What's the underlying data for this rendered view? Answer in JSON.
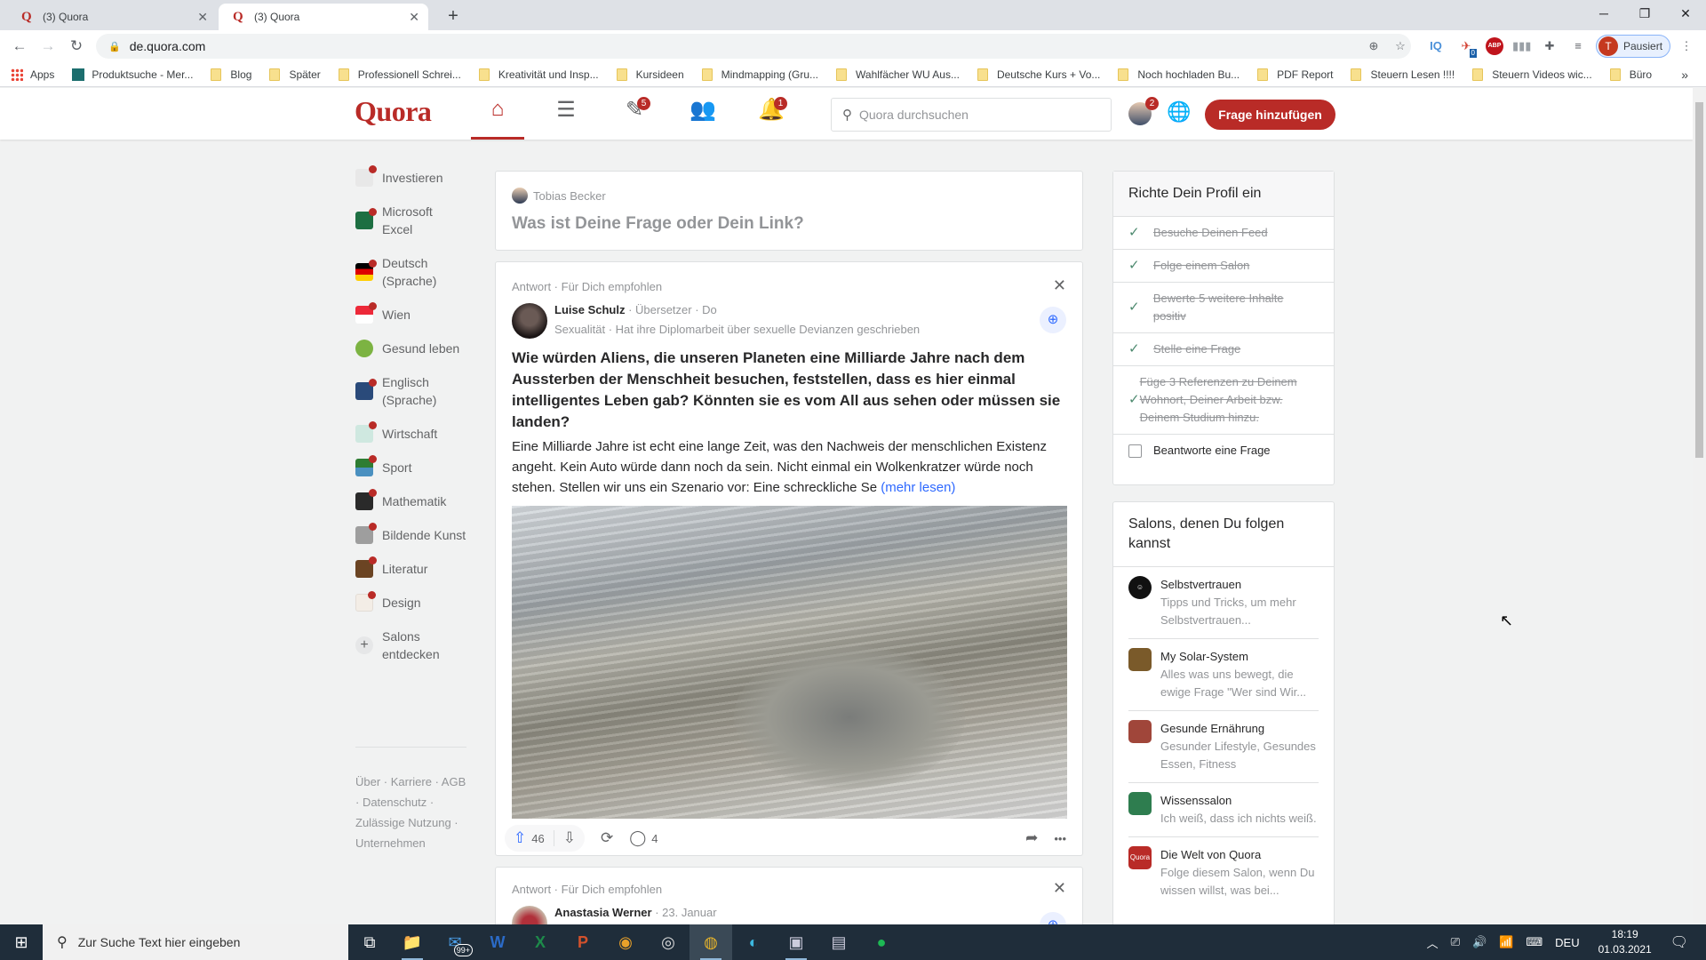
{
  "browser": {
    "tabs": [
      {
        "title": "(3) Quora",
        "active": false
      },
      {
        "title": "(3) Quora",
        "active": true
      }
    ],
    "url": "de.quora.com",
    "profile_initial": "T",
    "profile_label": "Pausiert",
    "extensions": [
      "zoom-icon",
      "star-icon",
      "IQ",
      "bird-extension-icon",
      "ABP",
      "bars-icon",
      "puzzle-icon",
      "media-icon"
    ],
    "ext_badge": "0",
    "bookmarks": [
      {
        "label": "Apps",
        "type": "apps"
      },
      {
        "label": "Produktsuche - Mer...",
        "type": "site"
      },
      {
        "label": "Blog",
        "type": "folder"
      },
      {
        "label": "Später",
        "type": "folder"
      },
      {
        "label": "Professionell Schrei...",
        "type": "folder"
      },
      {
        "label": "Kreativität und Insp...",
        "type": "folder"
      },
      {
        "label": "Kursideen",
        "type": "folder"
      },
      {
        "label": "Mindmapping  (Gru...",
        "type": "folder"
      },
      {
        "label": "Wahlfächer WU Aus...",
        "type": "folder"
      },
      {
        "label": "Deutsche Kurs + Vo...",
        "type": "folder"
      },
      {
        "label": "Noch hochladen Bu...",
        "type": "folder"
      },
      {
        "label": "PDF Report",
        "type": "folder"
      },
      {
        "label": "Steuern Lesen !!!!",
        "type": "folder"
      },
      {
        "label": "Steuern Videos wic...",
        "type": "folder"
      },
      {
        "label": "Büro",
        "type": "folder"
      }
    ],
    "bookmarks_more": "»"
  },
  "header": {
    "logo": "Quora",
    "nav": [
      {
        "name": "home",
        "badge": null,
        "active": true
      },
      {
        "name": "following",
        "badge": null
      },
      {
        "name": "answer",
        "badge": "5"
      },
      {
        "name": "spaces",
        "badge": null
      },
      {
        "name": "notifications",
        "badge": "1"
      }
    ],
    "search_placeholder": "Quora durchsuchen",
    "avatar_badge": "2",
    "add_question": "Frage hinzufügen"
  },
  "sidebar": {
    "items": [
      {
        "label": "Investieren",
        "color": "#e8e8e8",
        "dot": true
      },
      {
        "label": "Microsoft Excel",
        "color": "#1d6f42",
        "dot": true
      },
      {
        "label": "Deutsch (Sprache)",
        "color": "#dd0000",
        "dot": true
      },
      {
        "label": "Wien",
        "color": "#ed2939",
        "dot": true
      },
      {
        "label": "Gesund leben",
        "color": "#7cb342",
        "dot": false
      },
      {
        "label": "Englisch (Sprache)",
        "color": "#2a4a7a",
        "dot": true
      },
      {
        "label": "Wirtschaft",
        "color": "#cfe8e0",
        "dot": true
      },
      {
        "label": "Sport",
        "color": "#2e7d32",
        "dot": true
      },
      {
        "label": "Mathematik",
        "color": "#2a2a2a",
        "dot": true
      },
      {
        "label": "Bildende Kunst",
        "color": "#9e9e9e",
        "dot": true
      },
      {
        "label": "Literatur",
        "color": "#6b4423",
        "dot": true
      },
      {
        "label": "Design",
        "color": "#f3ede6",
        "dot": true
      }
    ],
    "discover": "Salons entdecken",
    "footer": "Über · Karriere · AGB · Datenschutz · Zulässige Nutzung · Unternehmen"
  },
  "ask": {
    "user": "Tobias Becker",
    "prompt": "Was ist Deine Frage oder Dein Link?"
  },
  "post": {
    "meta": "Antwort · Für Dich empfohlen",
    "author": "Luise Schulz",
    "author_info": " · Übersetzer · Do",
    "credential": "Sexualität · Hat ihre Diplomarbeit über sexuelle Devianzen geschrieben",
    "title": "Wie würden Aliens, die unseren Planeten eine Milliarde Jahre nach dem Aussterben der Menschheit besuchen, feststellen, dass es hier einmal intelligentes Leben gab? Könnten sie es vom All aus sehen oder müssen sie landen?",
    "body": "Eine Milliarde Jahre ist echt eine lange Zeit, was den Nachweis der menschlichen Existenz angeht. Kein Auto würde dann noch da sein. Nicht einmal ein Wolkenkratzer würde noch stehen. Stellen wir uns ein Szenario vor: Eine schreckliche Se",
    "more": "(mehr lesen)",
    "upvotes": "46",
    "comments": "4"
  },
  "post2": {
    "meta": "Antwort · Für Dich empfohlen",
    "author": "Anastasia Werner",
    "author_info": " · 23. Januar"
  },
  "profile_setup": {
    "title": "Richte Dein Profil ein",
    "items": [
      {
        "label": "Besuche Deinen Feed",
        "done": true
      },
      {
        "label": "Folge einem Salon",
        "done": true
      },
      {
        "label": "Bewerte 5 weitere Inhalte positiv",
        "done": true
      },
      {
        "label": "Stelle eine Frage",
        "done": true
      },
      {
        "label": "Füge 3 Referenzen zu Deinem Wohnort, Deiner Arbeit bzw. Deinem Studium hinzu.",
        "done": true
      },
      {
        "label": "Beantworte eine Frage",
        "done": false
      }
    ]
  },
  "salons": {
    "title": "Salons, denen Du folgen kannst",
    "items": [
      {
        "name": "Selbstvertrauen",
        "desc": "Tipps und Tricks, um mehr Selbstvertrauen...",
        "color": "#111111"
      },
      {
        "name": "My Solar-System",
        "desc": "Alles was uns bewegt, die ewige Frage \"Wer sind Wir...",
        "color": "#7a5a2a"
      },
      {
        "name": "Gesunde Ernährung",
        "desc": "Gesunder Lifestyle, Gesundes Essen, Fitness",
        "color": "#a0463a"
      },
      {
        "name": "Wissenssalon",
        "desc": "Ich weiß, dass ich nichts weiß.",
        "color": "#2e7d4f"
      },
      {
        "name": "Die Welt von Quora",
        "desc": "Folge diesem Salon, wenn Du wissen willst, was bei...",
        "color": "#b92b27"
      }
    ]
  },
  "taskbar": {
    "search_placeholder": "Zur Suche Text hier eingeben",
    "mail_badge": "99+",
    "language": "DEU",
    "time": "18:19",
    "date": "01.03.2021"
  }
}
